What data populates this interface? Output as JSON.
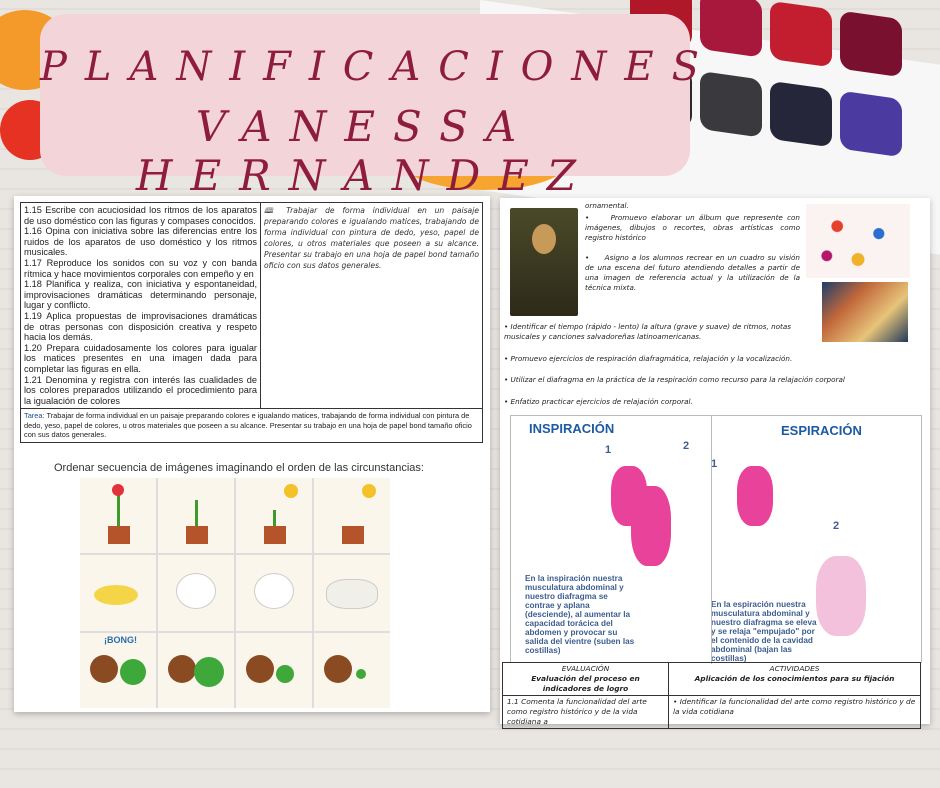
{
  "banner": {
    "line1": "PLANIFICACIONES",
    "line2": "VANESSA HERNANDEZ"
  },
  "left_doc": {
    "indicators": [
      "1.15 Escribe con acuciosidad los ritmos de los aparatos de uso doméstico con las figuras y compases conocidos.",
      "1.16 Opina con iniciativa sobre las diferencias entre los ruidos de los aparatos de uso doméstico y los ritmos musicales.",
      "1.17 Reproduce los sonidos con su voz y con banda rítmica y hace movimientos corporales con empeño y en",
      "1.18 Planifica y realiza, con iniciativa y espontaneidad, improvisaciones dramáticas determinando personaje, lugar y conflicto.",
      "1.19 Aplica propuestas de improvisaciones dramáticas de otras personas con disposición creativa y respeto hacia los demás.",
      "1.20 Prepara cuidadosamente los colores para igualar los matices presentes en una imagen dada para completar las figuras en ella.",
      "1.21 Denomina y registra con interés las cualidades de los colores preparados utilizando el procedimiento para la igualación de colores"
    ],
    "activity": "Trabajar de forma individual en un paisaje preparando colores e igualando matices, trabajando de forma individual con pintura de dedo, yeso, papel de colores, u otros materiales que poseen a su alcance. Presentar su trabajo en una hoja de papel bond tamaño oficio con sus datos generales.",
    "tarea_label": "Tarea:",
    "tarea": "Trabajar de forma individual en un paisaje preparando colores e igualando matices, trabajando de forma individual con pintura de dedo, yeso, papel de colores, u otros materiales que poseen a su alcance. Presentar su trabajo en una hoja de papel bond tamaño oficio con sus datos generales.",
    "sequence_title": "Ordenar secuencia de imágenes imaginando el orden de las circunstancias:",
    "bong": "¡BONG!"
  },
  "right_doc": {
    "ornamental": "ornamental.",
    "bullets_top": [
      "Promuevo elaborar un álbum que represente con imágenes, dibujos o recortes, obras artísticas como registro histórico",
      "Asigno a los alumnos recrear en un cuadro su visión de una escena del futuro atendiendo detalles a partir de una imagen de referencia actual y la utilización de la técnica mixta."
    ],
    "bullets": [
      "Identificar el tiempo (rápido - lento) la altura (grave y suave) de ritmos, notas musicales y canciones salvadoreñas latinoamericanas.",
      "Promuevo ejercicios de respiración diafragmática, relajación y la vocalización.",
      "Utilizar el diafragma en la práctica de la respiración como recurso para la relajación corporal",
      "Enfatizo practicar ejercicios de relajación corporal."
    ],
    "diagram": {
      "inspiracion": "INSPIRACIÓN",
      "espiracion": "ESPIRACIÓN",
      "n1": "1",
      "n2": "2",
      "n1b": "1",
      "n2b": "2",
      "insp_text": "En la inspiración nuestra musculatura abdominal y nuestro diafragma se contrae y aplana (desciende), al aumentar la capacidad torácica del abdomen y provocar su salida del vientre (suben las costillas)",
      "esp_text": "En la espiración nuestra musculatura abdominal y nuestro diafragma se eleva y se relaja \"empujado\" por el contenido de la cavidad abdominal (bajan las costillas)"
    },
    "table": {
      "h1": "EVALUACIÓN",
      "h1b": "Evaluación del proceso en indicadores de logro",
      "h2": "ACTIVIDADES",
      "h2b": "Aplicación de los conocimientos para su fijación",
      "c1": "1.1 Comenta la funcionalidad del arte como registro histórico y de la vida cotidiana a",
      "c2": "Identificar la funcionalidad del arte como registro histórico y de la vida cotidiana"
    }
  }
}
